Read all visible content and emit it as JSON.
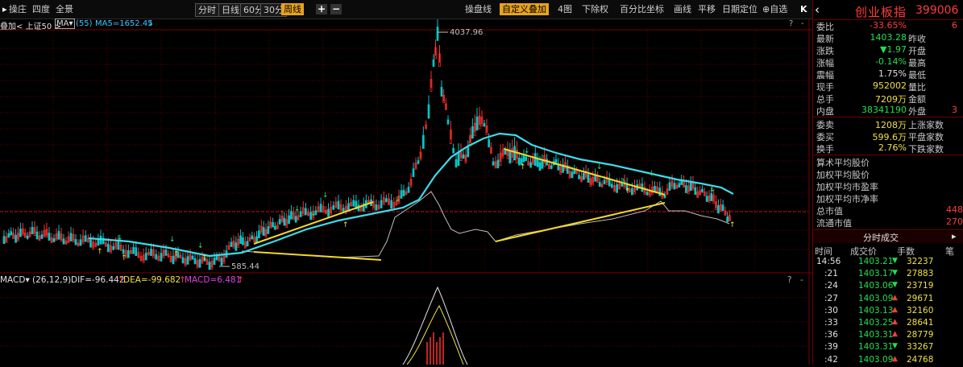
{
  "toolbar": {
    "menu": [
      "操庄",
      "四度",
      "全景"
    ],
    "periods": [
      "分时",
      "日线",
      "60分",
      "30分",
      "周线"
    ],
    "active_period": "周线",
    "right_buttons": [
      "操盘线",
      "自定义叠加",
      "4图",
      "下除权",
      "百分比坐标",
      "画线",
      "平移",
      "日期定位",
      "自选"
    ],
    "collapse": "K"
  },
  "infoline": {
    "overlay": "叠加< 上证50 >",
    "ma_select": "MA▾",
    "ma_param": "(55)",
    "ma5": "MA5=1652.45",
    "ma_arrow": "↓",
    "help": "?",
    "close": "-"
  },
  "chart": {
    "high_label": "4037.96",
    "low_label": "585.44",
    "macd_title": "MACD▾",
    "macd_param": "(26,12,9)",
    "dif": "DIF=-96.442",
    "dea": "DEA=-99.682",
    "macd": "MACD=6.481",
    "up_arrow": "↑",
    "macd_help": "?",
    "macd_close": "-"
  },
  "panel": {
    "title": "创业板指",
    "code": "399006",
    "icon_left": "‹",
    "stats": [
      {
        "label": "委比",
        "value": "-33.65%",
        "color": "#ff3b3b",
        "label2": "",
        "value2": "6"
      },
      {
        "label": "最新",
        "value": "1403.28",
        "color": "#20e050",
        "label2": "昨收",
        "value2": ""
      },
      {
        "label": "涨跌",
        "value": "▼1.97",
        "color": "#20e050",
        "label2": "开盘",
        "value2": ""
      },
      {
        "label": "涨幅",
        "value": "-0.14%",
        "color": "#20e050",
        "label2": "最高",
        "value2": ""
      },
      {
        "label": "震幅",
        "value": "1.75%",
        "color": "#e0e0e0",
        "label2": "最低",
        "value2": ""
      },
      {
        "label": "现手",
        "value": "952002",
        "color": "#f0e040",
        "label2": "量比",
        "value2": ""
      },
      {
        "label": "总手",
        "value": "7209万",
        "color": "#f0e040",
        "label2": "金额",
        "value2": ""
      },
      {
        "label": "内盘",
        "value": "38341190",
        "color": "#20e050",
        "label2": "外盘",
        "value2": "3"
      }
    ],
    "stats2": [
      {
        "label": "委卖",
        "value": "1208万",
        "color": "#f0e040",
        "label2": "上涨家数"
      },
      {
        "label": "委买",
        "value": "599.6万",
        "color": "#f0e040",
        "label2": "平盘家数"
      },
      {
        "label": "换手",
        "value": "2.76%",
        "color": "#f0e040",
        "label2": "下跌家数"
      }
    ],
    "averages": [
      "算术平均股价",
      "加权平均股价",
      "加权平均市盈率",
      "加权平均市净率"
    ],
    "caps": [
      {
        "label": "总市值",
        "value": "448"
      },
      {
        "label": "流通市值",
        "value": "270"
      }
    ],
    "trade_tab": "分时成交",
    "trade_headers": [
      "时间",
      "成交价",
      "手数",
      "笔"
    ],
    "trades": [
      {
        "time": "14:56",
        "price": "1403.21",
        "dir": "▼",
        "dcolor": "#20e050",
        "vol": "32237"
      },
      {
        "time": ":21",
        "price": "1403.17",
        "dir": "▼",
        "dcolor": "#20e050",
        "vol": "27883"
      },
      {
        "time": ":24",
        "price": "1403.06",
        "dir": "▼",
        "dcolor": "#20e050",
        "vol": "23719"
      },
      {
        "time": ":27",
        "price": "1403.09",
        "dir": "▲",
        "dcolor": "#ff3b3b",
        "vol": "29671"
      },
      {
        "time": ":30",
        "price": "1403.13",
        "dir": "▲",
        "dcolor": "#ff3b3b",
        "vol": "32160"
      },
      {
        "time": ":33",
        "price": "1403.25",
        "dir": "▲",
        "dcolor": "#ff3b3b",
        "vol": "28641"
      },
      {
        "time": ":36",
        "price": "1403.31",
        "dir": "▲",
        "dcolor": "#ff3b3b",
        "vol": "28779"
      },
      {
        "time": ":39",
        "price": "1403.31",
        "dir": "▼",
        "dcolor": "#20e050",
        "vol": "33267"
      },
      {
        "time": ":42",
        "price": "1403.09",
        "dir": "▲",
        "dcolor": "#ff3b3b",
        "vol": "24768"
      }
    ]
  }
}
